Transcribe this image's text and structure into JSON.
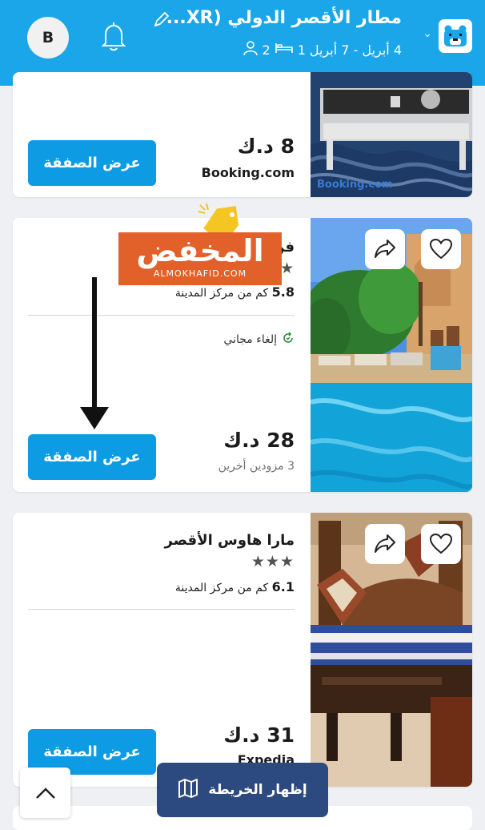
{
  "header": {
    "title": "مطار الأقصر الدولي (XR...",
    "dates": "4 أبريل - 7 أبريل",
    "rooms": "1",
    "guests": "2",
    "avatar_letter": "B",
    "bg_color": "#1aa6e8"
  },
  "listings": [
    {
      "price": "8 د.ك",
      "provider": "Booking.com",
      "photo_caption": "Booking.com",
      "button_label": "عرض الصفقة"
    },
    {
      "name": "فن",
      "stars": "★",
      "distance_value": "5.8",
      "distance_text": "كم من مركز المدينة",
      "cancellation": "إلغاء مجاني",
      "price": "28 د.ك",
      "providers_count": "3 مزودين أخرين",
      "button_label": "عرض الصفقة"
    },
    {
      "name": "مارا هاوس الأقصر",
      "stars": "★★★",
      "distance_value": "6.1",
      "distance_text": "كم من مركز المدينة",
      "price": "31 د.ك",
      "provider": "Expedia",
      "button_label": "عرض الصفقة"
    }
  ],
  "map_button": {
    "label": "إظهار الخريطة"
  },
  "watermark": {
    "main": "المخفض",
    "sub": "ALMOKHAFID.COM"
  },
  "colors": {
    "deal_button": "#0d9be3",
    "map_button": "#2d4a80"
  }
}
